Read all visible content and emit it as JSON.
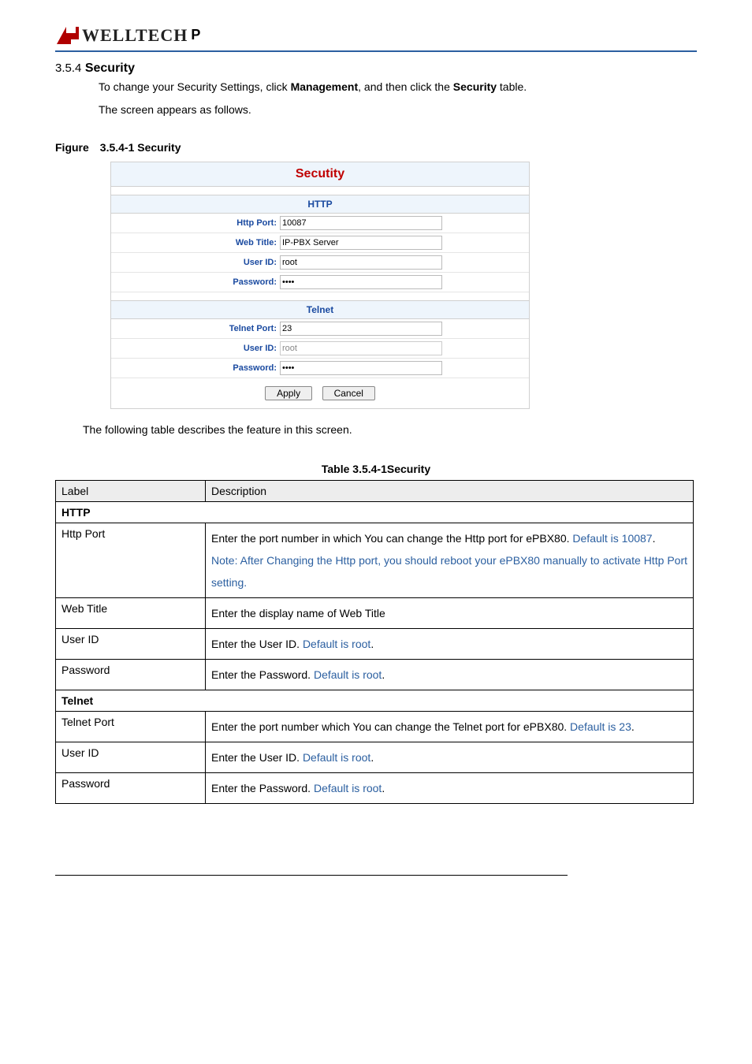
{
  "logo": {
    "brand": "WELLTECH",
    "suffix": "P"
  },
  "heading": {
    "num": "3.5.4",
    "title": "Security"
  },
  "intro1_a": "To change your Security Settings, click ",
  "intro1_b": "Management",
  "intro1_c": ", and then click the ",
  "intro1_d": "Security",
  "intro1_e": " table.",
  "intro2": "The screen appears as follows.",
  "figcap_a": "Figure",
  "figcap_b": "3.5.4-1 Security",
  "ui": {
    "title": "Secutity",
    "http_head": "HTTP",
    "http_port_label": "Http Port:",
    "http_port_value": "10087",
    "web_title_label": "Web Title:",
    "web_title_value": "IP-PBX Server",
    "userid_label": "User ID:",
    "userid_value": "root",
    "password_label": "Password:",
    "password_value": "••••",
    "telnet_head": "Telnet",
    "telnet_port_label": "Telnet Port:",
    "telnet_port_value": "23",
    "t_userid_label": "User ID:",
    "t_userid_value": "root",
    "t_password_label": "Password:",
    "t_password_value": "••••",
    "apply": "Apply",
    "cancel": "Cancel"
  },
  "after": "The following table describes the feature in this screen.",
  "tblcap": "Table 3.5.4-1Security",
  "table": {
    "h_label": "Label",
    "h_desc": "Description",
    "http": "HTTP",
    "httpport_l": "Http Port",
    "httpport_d1": "Enter the port number in which You can change the Http port for ePBX80. ",
    "httpport_d1b": "Default is 10087",
    "httpport_d1c": ".",
    "httpport_d2": "Note: After Changing the Http port, you should reboot your ePBX80 manually to activate Http Port setting.",
    "webtitle_l": "Web Title",
    "webtitle_d": "Enter the display name of Web Title",
    "userid_l": "User ID",
    "userid_d1": "Enter the User ID. ",
    "userid_d2": "Default is root",
    "userid_d3": ".",
    "pwd_l": "Password",
    "pwd_d1": "Enter the Password. ",
    "pwd_d2": "Default is root",
    "pwd_d3": ".",
    "telnet": "Telnet",
    "telport_l": "Telnet Port",
    "telport_d1": "Enter the port number which You can change the Telnet port for ePBX80. ",
    "telport_d2": "Default is 23",
    "telport_d3": ".",
    "tuserid_l": "User ID",
    "tuserid_d1": "Enter the User ID. ",
    "tuserid_d2": "Default is root",
    "tuserid_d3": ".",
    "tpwd_l": "Password",
    "tpwd_d1": "Enter the Password. ",
    "tpwd_d2": "Default is root",
    "tpwd_d3": "."
  }
}
